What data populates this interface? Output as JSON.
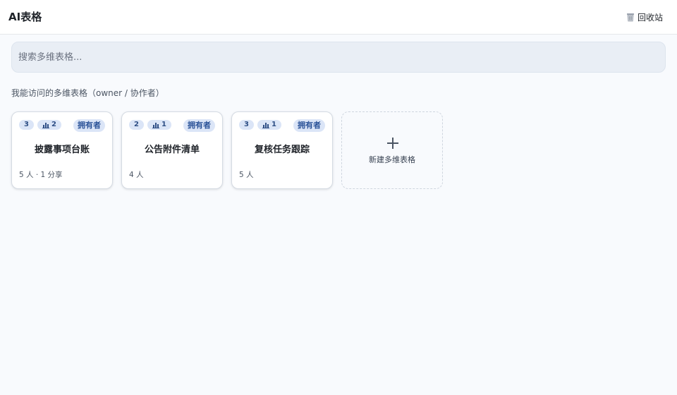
{
  "header": {
    "title": "AI表格",
    "recycle_label": "回收站"
  },
  "search": {
    "placeholder": "搜索多维表格..."
  },
  "section": {
    "title": "我能访问的多维表格（owner / 协作者）"
  },
  "cards": [
    {
      "count": "3",
      "chart_count": "2",
      "role": "拥有者",
      "title": "披露事项台账",
      "meta": "5 人 · 1 分享"
    },
    {
      "count": "2",
      "chart_count": "1",
      "role": "拥有者",
      "title": "公告附件清单",
      "meta": "4 人"
    },
    {
      "count": "3",
      "chart_count": "1",
      "role": "拥有者",
      "title": "复核任务跟踪",
      "meta": "5 人"
    }
  ],
  "new_card": {
    "label": "新建多维表格"
  },
  "colors": {
    "background": "#f8fafd",
    "badge_bg": "#dbe5f7",
    "badge_text": "#2a5298"
  },
  "icons": {
    "recycle": "trash-icon",
    "chart": "bar-chart-icon",
    "add": "plus-icon"
  }
}
